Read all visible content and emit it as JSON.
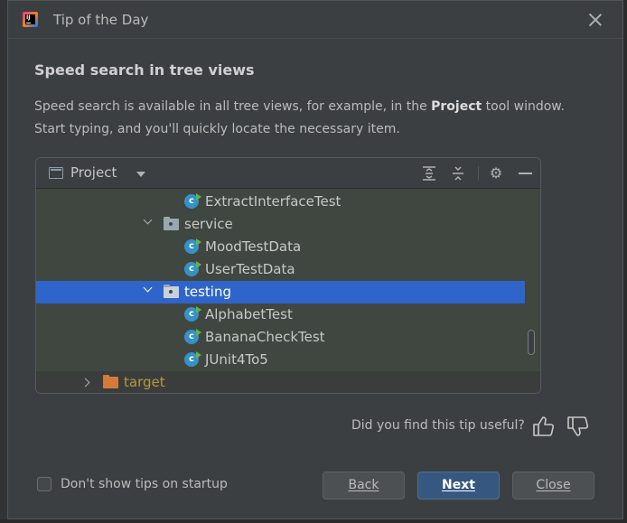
{
  "window": {
    "title": "Tip of the Day"
  },
  "tip": {
    "heading": "Speed search in tree views",
    "text_before": "Speed search is available in all tree views, for example, in the ",
    "text_bold": "Project",
    "text_after": " tool window. Start typing, and you'll quickly locate the necessary item."
  },
  "project_window": {
    "title": "Project",
    "tree": [
      {
        "label": "ExtractInterfaceTest",
        "kind": "class",
        "expanded": null,
        "selected": false
      },
      {
        "label": "service",
        "kind": "package",
        "expanded": true,
        "selected": false
      },
      {
        "label": "MoodTestData",
        "kind": "class",
        "expanded": null,
        "selected": false
      },
      {
        "label": "UserTestData",
        "kind": "class",
        "expanded": null,
        "selected": false
      },
      {
        "label": "testing",
        "kind": "package",
        "expanded": true,
        "selected": true
      },
      {
        "label": "AlphabetTest",
        "kind": "class",
        "expanded": null,
        "selected": false
      },
      {
        "label": "BananaCheckTest",
        "kind": "class",
        "expanded": null,
        "selected": false
      },
      {
        "label": "JUnit4To5",
        "kind": "class",
        "expanded": null,
        "selected": false
      },
      {
        "label": "target",
        "kind": "excluded-folder",
        "expanded": false,
        "selected": false
      }
    ],
    "icons": [
      "expand-all-icon",
      "collapse-all-icon",
      "gear-icon",
      "minimize-icon"
    ]
  },
  "feedback": {
    "question": "Did you find this tip useful?"
  },
  "footer": {
    "dont_show_label": "Don't show tips on startup",
    "dont_show_checked": false,
    "back_label": "Back",
    "next_label": "Next",
    "close_label": "Close"
  },
  "colors": {
    "dialog_bg": "#3c3f41",
    "selection": "#2f65ca",
    "primary_button": "#365880",
    "tree_bg": "#404741",
    "excluded_folder_text": "#b39b3d"
  }
}
